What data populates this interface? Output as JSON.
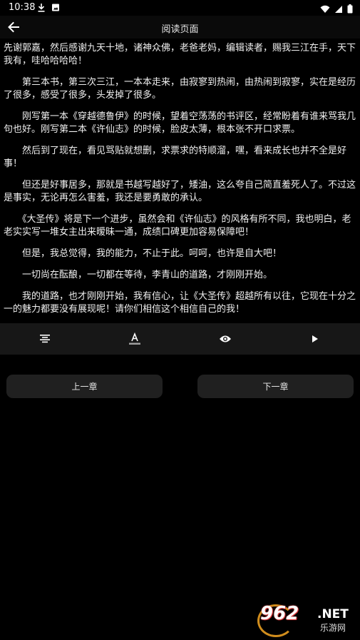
{
  "status_bar": {
    "time": "10:38",
    "left_icons": [
      "download-icon",
      "photo-icon"
    ],
    "right_icons": [
      "wifi-icon",
      "cell-signal-icon",
      "battery-icon"
    ]
  },
  "app_bar": {
    "title": "阅读页面",
    "back_icon": "arrow-back-icon"
  },
  "content": {
    "paragraphs": [
      "先谢郭嘉，然后感谢九天十地，诸神众佛，老爸老妈，编辑读者，赐我三江在手，天下我有，哇哈哈哈哈！",
      "　　第三本书，第三次三江，一本本走来，由寂寥到热闹，由热闹到寂寥，实在是经历了很多，感受了很多，头发掉了很多。",
      "　　刚写第一本《穿越德鲁伊》的时候，望着空荡荡的书评区，经常盼着有谁来骂我几句也好。刚写第二本《许仙志》的时候，脸皮太薄，根本张不开口求票。",
      "　　然后到了现在，看见骂贴就想删，求票求的特顺溜，嘿，看来成长也并不全是好事！",
      "　　但还是好事居多，那就是书越写越好了，矮油，这么夸自己简直羞死人了。不过这是事实，无论再怎么害羞，我还是要勇敢的承认。",
      "　　《大圣传》将是下一个进步，虽然会和《许仙志》的风格有所不同，我也明白，老老实实写一堆女主出来暧昧一通，成绩口碑更加容易保障吧！",
      "　　但是，我总觉得，我的能力，不止于此。呵呵，也许是自大吧！",
      "　　一切尚在酝酿，一切都在等待，李青山的道路，才刚刚开始。",
      "　　我的道路，也才刚刚开始，我有信心，让《大圣传》超越所有以往，它现在十分之一的魅力都要没有展现呢！请你们相信这个相信自己的我！"
    ]
  },
  "toolbar": {
    "items": [
      {
        "name": "align-text-icon"
      },
      {
        "name": "font-color-icon"
      },
      {
        "name": "eye-icon"
      },
      {
        "name": "play-icon"
      }
    ]
  },
  "navigation": {
    "prev_label": "上一章",
    "next_label": "下一章"
  },
  "watermark": {
    "logo_text": "962",
    "net_text": ".NET",
    "sub_text": "乐游网"
  }
}
